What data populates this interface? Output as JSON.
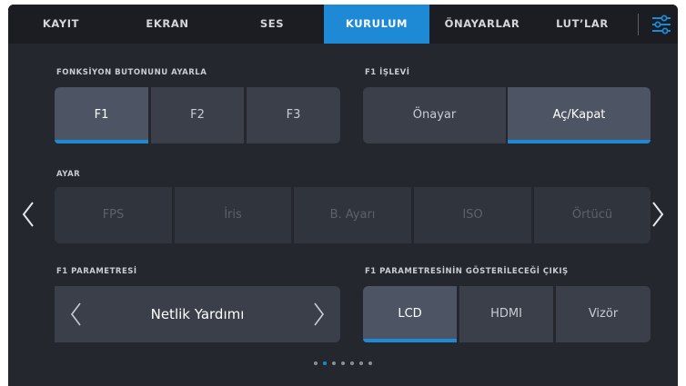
{
  "tabs": [
    {
      "label": "KAYIT"
    },
    {
      "label": "EKRAN"
    },
    {
      "label": "SES"
    },
    {
      "label": "KURULUM"
    },
    {
      "label": "ÖNAYARLAR"
    },
    {
      "label": "LUT’LAR"
    }
  ],
  "active_tab": "KURULUM",
  "menu_icon": "sliders-icon",
  "function_button": {
    "label": "FONKSİYON BUTONUNU AYARLA",
    "options": [
      "F1",
      "F2",
      "F3"
    ],
    "selected": "F1"
  },
  "f1_function": {
    "label": "F1 İŞLEVİ",
    "options": [
      "Önayar",
      "Aç/Kapat"
    ],
    "selected": "Aç/Kapat"
  },
  "setting": {
    "label": "AYAR",
    "options": [
      "FPS",
      "İris",
      "B. Ayarı",
      "ISO",
      "Örtücü"
    ]
  },
  "f1_parameter": {
    "label": "F1 PARAMETRESİ",
    "value": "Netlik Yardımı"
  },
  "f1_output": {
    "label": "F1 PARAMETRESİNİN GÖSTERİLECEĞİ ÇIKIŞ",
    "options": [
      "LCD",
      "HDMI",
      "Vizör"
    ],
    "selected": "LCD"
  },
  "pagination": {
    "total": 7,
    "current": 2
  },
  "colors": {
    "accent": "#1e8ad6",
    "background": "#24272e",
    "tabbar": "#1b1d22"
  }
}
